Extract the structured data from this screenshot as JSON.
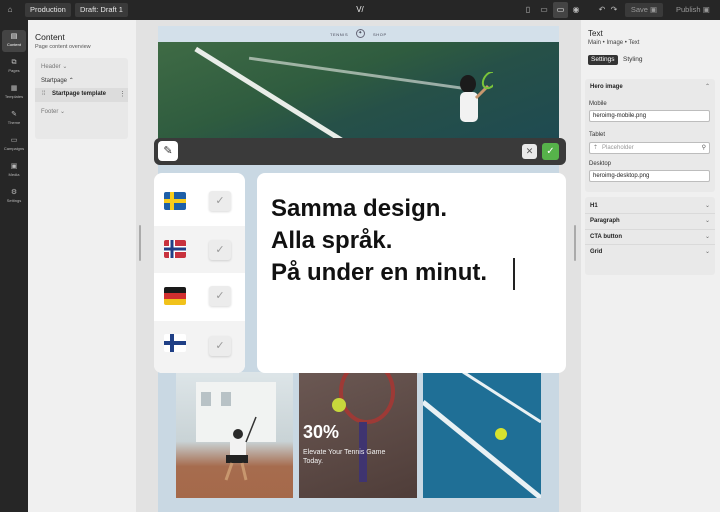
{
  "topbar": {
    "environment": "Production",
    "draft": "Draft: Draft 1",
    "logo": "V/",
    "save_label": "Save",
    "publish_label": "Publish",
    "colors": {
      "bg": "#262626",
      "accent": "#56b24a"
    }
  },
  "leftnav": {
    "items": [
      {
        "label": "Content",
        "icon": "content-icon"
      },
      {
        "label": "Pages",
        "icon": "pages-icon"
      },
      {
        "label": "Templates",
        "icon": "templates-icon"
      },
      {
        "label": "Theme",
        "icon": "theme-icon"
      },
      {
        "label": "Campaigns",
        "icon": "campaigns-icon"
      },
      {
        "label": "Media",
        "icon": "media-icon"
      },
      {
        "label": "Settings",
        "icon": "settings-icon"
      }
    ]
  },
  "content_panel": {
    "title": "Content",
    "subtitle": "Page content overview",
    "tree": {
      "header": "Header",
      "startpage": "Startpage",
      "template": "Startpage template",
      "footer": "Footer"
    }
  },
  "preview": {
    "nav": {
      "left": "TENNIS",
      "right": "SHOP"
    },
    "promo": {
      "percent": "30%",
      "text": "Elevate Your Tennis Game Today."
    }
  },
  "overlay": {
    "languages": [
      {
        "flag": "sweden-flag"
      },
      {
        "flag": "norway-flag"
      },
      {
        "flag": "germany-flag"
      },
      {
        "flag": "finland-flag"
      }
    ],
    "message": {
      "line1": "Samma design.",
      "line2": "Alla språk.",
      "line3": "På under en minut."
    }
  },
  "inspector": {
    "title": "Text",
    "breadcrumb": "Main  •  Image  •  Text",
    "tabs": {
      "settings": "Settings",
      "styling": "Styling"
    },
    "hero_section": "Hero image",
    "mobile_label": "Mobile",
    "mobile_value": "heroimg-mobile.png",
    "tablet_label": "Tablet",
    "tablet_placeholder": "Placeholder",
    "desktop_label": "Desktop",
    "desktop_value": "heroimg-desktop.png",
    "sections": [
      "H1",
      "Paragraph",
      "CTA button",
      "Grid"
    ]
  }
}
